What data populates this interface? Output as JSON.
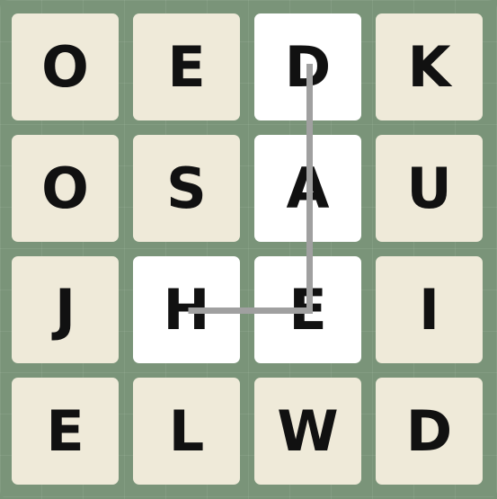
{
  "board": {
    "rows": [
      [
        "O",
        "E",
        "D",
        "K"
      ],
      [
        "O",
        "S",
        "A",
        "U"
      ],
      [
        "J",
        "H",
        "E",
        "I"
      ],
      [
        "E",
        "L",
        "W",
        "D"
      ]
    ],
    "selected_path": [
      [
        0,
        2
      ],
      [
        1,
        2
      ],
      [
        2,
        2
      ],
      [
        2,
        1
      ]
    ],
    "colors": {
      "background": "#7a9479",
      "tile": "#efead9",
      "tile_selected": "#ffffff",
      "path_line": "#a0a0a0",
      "letter": "#111111"
    }
  }
}
